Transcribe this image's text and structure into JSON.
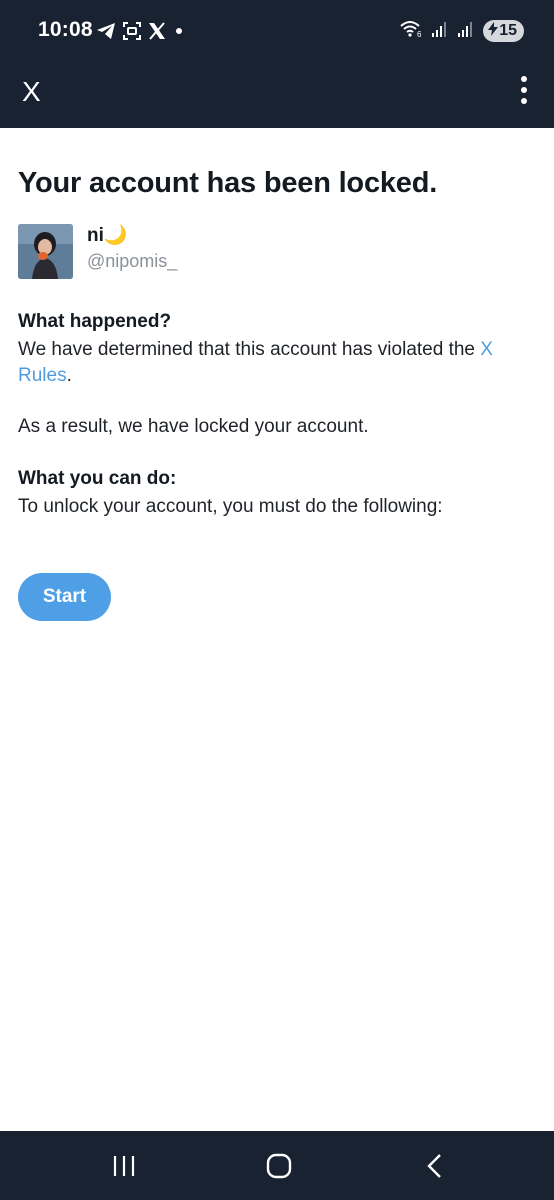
{
  "status_bar": {
    "time": "10:08",
    "left_icons": [
      "telegram-icon",
      "screenshot-icon",
      "x-logo-icon",
      "notification-dot-icon"
    ],
    "right_icons": [
      "wifi-6-icon",
      "signal-icon",
      "signal-icon"
    ],
    "battery_level": "15",
    "battery_charging": true
  },
  "header": {
    "title": "X",
    "menu_icon": "more-vertical-icon"
  },
  "main": {
    "title": "Your account has been locked.",
    "profile": {
      "display_name": "ni🌙",
      "handle": "@nipomis_"
    },
    "what_happened": {
      "heading": "What happened?",
      "text_before_link": "We have determined that this account has violated the ",
      "link_text": "X Rules",
      "text_after_link": "."
    },
    "result_text": "As a result, we have locked your account.",
    "what_you_can_do": {
      "heading": "What you can do:",
      "text": "To unlock your account, you must do the following:"
    },
    "start_button": "Start"
  },
  "nav_bar": {
    "buttons": [
      "recents-icon",
      "home-icon",
      "back-icon"
    ]
  },
  "colors": {
    "bar_background": "#182230",
    "link": "#4f9cde",
    "button": "#4f9fe6"
  }
}
